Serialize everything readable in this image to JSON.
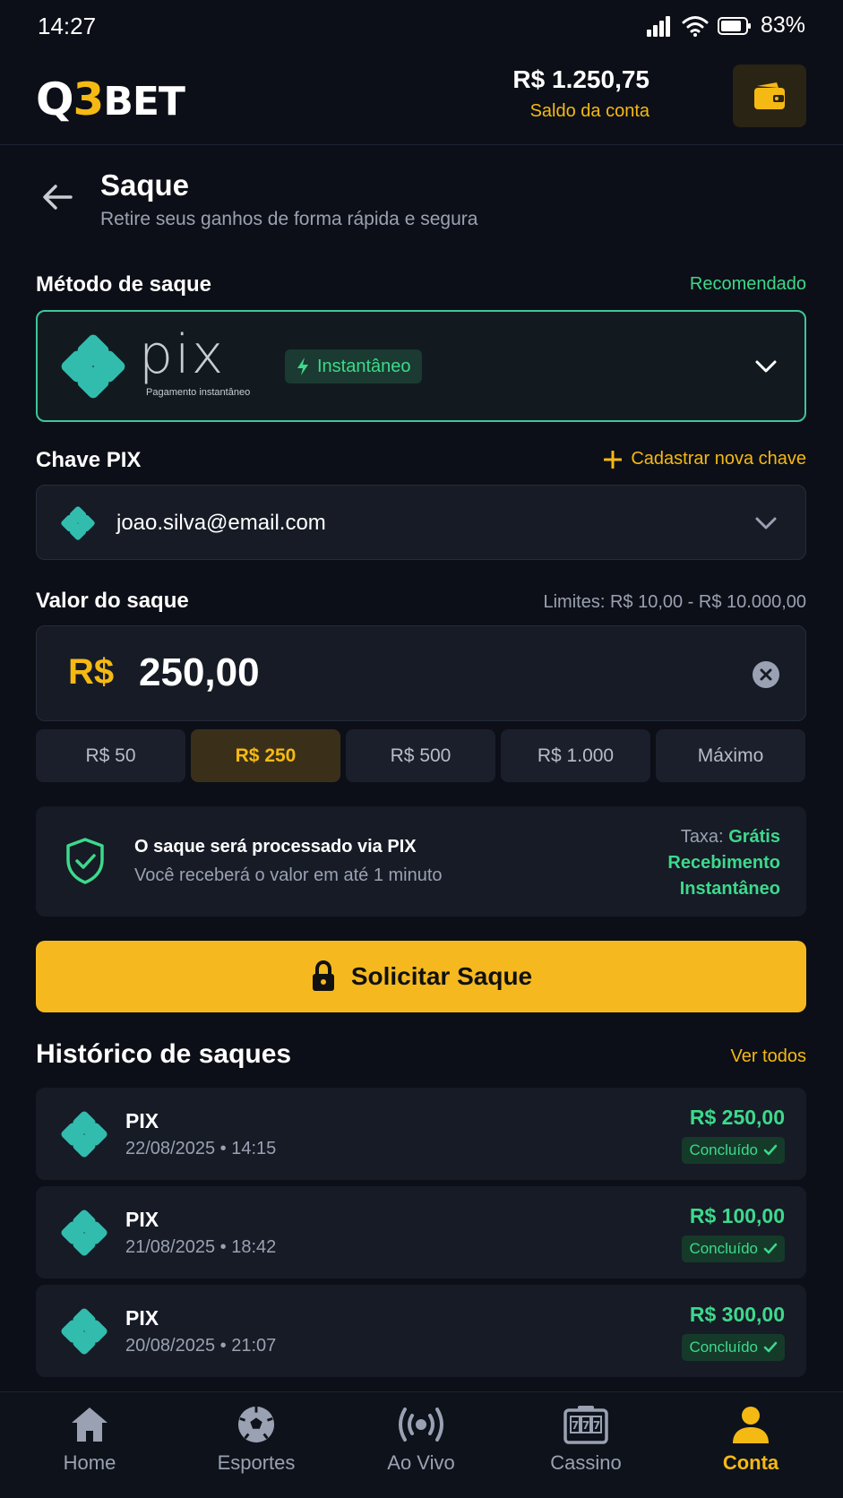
{
  "status_bar": {
    "time": "14:27",
    "battery": "83%"
  },
  "header": {
    "logo_q": "Q",
    "logo_3": "3",
    "logo_bet": "BET",
    "balance": "R$ 1.250,75",
    "balance_label": "Saldo da conta"
  },
  "page": {
    "title": "Saque",
    "subtitle": "Retire seus ganhos de forma rápida e segura"
  },
  "method": {
    "label": "Método de saque",
    "recommended": "Recomendado",
    "name": "pix",
    "caption": "Pagamento instantâneo",
    "badge": "Instantâneo"
  },
  "pix_key": {
    "label": "Chave PIX",
    "add_label": "Cadastrar nova chave",
    "value": "joao.silva@email.com"
  },
  "amount": {
    "label": "Valor do saque",
    "limits": "Limites: R$ 10,00 - R$ 10.000,00",
    "currency": "R$",
    "value": "250,00",
    "quick": [
      "R$ 50",
      "R$ 250",
      "R$ 500",
      "R$ 1.000",
      "Máximo"
    ],
    "selected": "R$ 250"
  },
  "info": {
    "title": "O saque será processado via PIX",
    "subtitle": "Você receberá o valor em até 1 minuto",
    "fee_label": "Taxa:",
    "fee_value": "Grátis",
    "receipt_1": "Recebimento",
    "receipt_2": "Instantâneo"
  },
  "submit_label": "Solicitar Saque",
  "history": {
    "title": "Histórico de saques",
    "see_all": "Ver todos",
    "items": [
      {
        "method": "PIX",
        "date": "22/08/2025 • 14:15",
        "amount": "R$ 250,00",
        "status": "Concluído"
      },
      {
        "method": "PIX",
        "date": "21/08/2025 • 18:42",
        "amount": "R$ 100,00",
        "status": "Concluído"
      },
      {
        "method": "PIX",
        "date": "20/08/2025 • 21:07",
        "amount": "R$ 300,00",
        "status": "Concluído"
      }
    ]
  },
  "nav": {
    "items": [
      {
        "label": "Home",
        "icon": "home-icon"
      },
      {
        "label": "Esportes",
        "icon": "soccer-ball-icon"
      },
      {
        "label": "Ao Vivo",
        "icon": "live-broadcast-icon"
      },
      {
        "label": "Cassino",
        "icon": "slot-machine-icon"
      },
      {
        "label": "Conta",
        "icon": "user-icon"
      }
    ],
    "active": "Conta"
  },
  "colors": {
    "accent": "#f5b914",
    "success": "#3dd98b",
    "pix": "#32bcad",
    "background": "#0c0f17"
  }
}
